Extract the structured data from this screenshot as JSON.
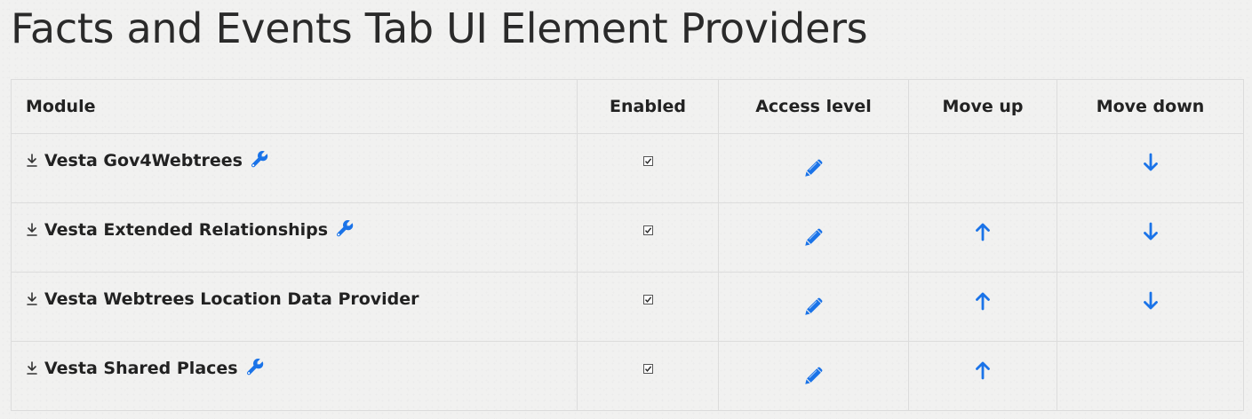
{
  "page": {
    "title": "Facts and Events Tab UI Element Providers"
  },
  "table": {
    "headers": {
      "module": "Module",
      "enabled": "Enabled",
      "access_level": "Access level",
      "move_up": "Move up",
      "move_down": "Move down"
    },
    "rows": [
      {
        "name": "Vesta Gov4Webtrees",
        "has_settings": true,
        "enabled": true,
        "can_move_up": false,
        "can_move_down": true
      },
      {
        "name": "Vesta Extended Relationships",
        "has_settings": true,
        "enabled": true,
        "can_move_up": true,
        "can_move_down": true
      },
      {
        "name": "Vesta Webtrees Location Data Provider",
        "has_settings": false,
        "enabled": true,
        "can_move_up": true,
        "can_move_down": true
      },
      {
        "name": "Vesta Shared Places",
        "has_settings": true,
        "enabled": true,
        "can_move_up": true,
        "can_move_down": false
      }
    ]
  },
  "icons": {
    "drag": "drag-handle-icon",
    "settings": "wrench-icon",
    "access": "pencil-icon",
    "up": "arrow-up-icon",
    "down": "arrow-down-icon"
  },
  "colors": {
    "accent": "#1a73e8",
    "text": "#222222",
    "border": "#dcdcdc",
    "background": "#f1f1f0"
  }
}
